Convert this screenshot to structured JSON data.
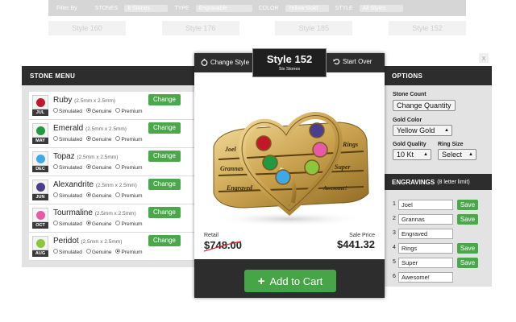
{
  "background": {
    "filter_by": "Filter By",
    "filters": [
      {
        "label": "STONES",
        "value": "6 Stones"
      },
      {
        "label": "TYPE",
        "value": "Engravable"
      },
      {
        "label": "COLOR",
        "value": "Yellow Gold"
      },
      {
        "label": "STYLE",
        "value": "All Styles"
      }
    ],
    "styles": [
      "Style 160",
      "Style 176",
      "Style 185",
      "Style 152"
    ],
    "close": "x"
  },
  "stone_menu": {
    "title": "STONE MENU",
    "change_label": "Change",
    "options": [
      "Simulated",
      "Genuine",
      "Premium"
    ],
    "stones": [
      {
        "name": "Ruby",
        "size": "(2.5mm x 2.5mm)",
        "month": "JUL",
        "color": "#c4162a",
        "selected": 1
      },
      {
        "name": "Emerald",
        "size": "(2.5mm x 2.5mm)",
        "month": "MAY",
        "color": "#1f9a3e",
        "selected": 1
      },
      {
        "name": "Topaz",
        "size": "(2.5mm x 2.5mm)",
        "month": "DEC",
        "color": "#3fa8e6",
        "selected": 1
      },
      {
        "name": "Alexandrite",
        "size": "(2.5mm x 2.5mm)",
        "month": "JUN",
        "color": "#4a3f8c",
        "selected": 1
      },
      {
        "name": "Tourmaline",
        "size": "(2.5mm x 2.5mm)",
        "month": "OCT",
        "color": "#e85aa8",
        "selected": 1
      },
      {
        "name": "Peridot",
        "size": "(2.5mm x 2.5mm)",
        "month": "AUG",
        "color": "#8cc63e",
        "selected": 2
      }
    ]
  },
  "modal": {
    "change_style": "Change Style",
    "title": "Style 152",
    "subtitle": "Six Stones",
    "start_over": "Start Over",
    "engravings_on_ring": [
      "Joel",
      "Grannas",
      "Engraved",
      "Rings",
      "Super",
      "Awesome!"
    ],
    "retail_label": "Retail",
    "retail_price": "$748.00",
    "sale_label": "Sale Price",
    "sale_price": "$441.32",
    "add_to_cart": "Add to Cart"
  },
  "options": {
    "title": "OPTIONS",
    "stone_count_label": "Stone Count",
    "change_quantity": "Change Quantity",
    "gold_color_label": "Gold Color",
    "gold_color": "Yellow Gold",
    "gold_quality_label": "Gold Quality",
    "gold_quality": "10 Kt",
    "ring_size_label": "Ring Size",
    "ring_size": "Select",
    "engravings_title": "ENGRAVINGS",
    "engravings_limit": "(8 letter limit)",
    "save_label": "Save",
    "engravings": [
      {
        "num": "1",
        "text": "Joel",
        "save": true
      },
      {
        "num": "2",
        "text": "Grannas",
        "save": true
      },
      {
        "num": "3",
        "text": "Engraved",
        "save": false
      },
      {
        "num": "4",
        "text": "Rings",
        "save": true
      },
      {
        "num": "5",
        "text": "Super",
        "save": true
      },
      {
        "num": "6",
        "text": "Awesome!",
        "save": false
      }
    ]
  }
}
